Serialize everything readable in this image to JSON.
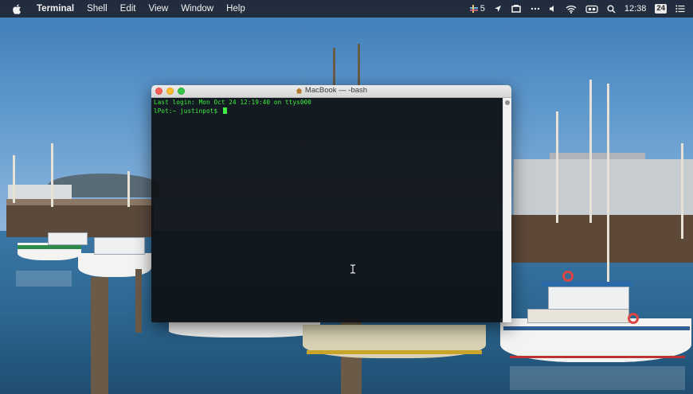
{
  "menubar": {
    "app_name": "Terminal",
    "items": [
      "Shell",
      "Edit",
      "View",
      "Window",
      "Help"
    ],
    "status": {
      "battery_extension_count": "5",
      "clock": "12:38",
      "badge": "24",
      "icons": [
        "slack-icon",
        "location-arrow-icon",
        "dropbox-icon",
        "more-dots-icon",
        "volume-icon",
        "wifi-icon",
        "display-icon",
        "search-icon",
        "calendar-badge-icon",
        "notification-center-icon"
      ]
    }
  },
  "terminal": {
    "title": "MacBook — -bash",
    "lines": [
      "Last login: Mon Oct 24 12:19:40 on ttys000",
      "lPot:~ justinpot$ "
    ],
    "text_color": "#3ff23f",
    "background": "#0e1014"
  }
}
